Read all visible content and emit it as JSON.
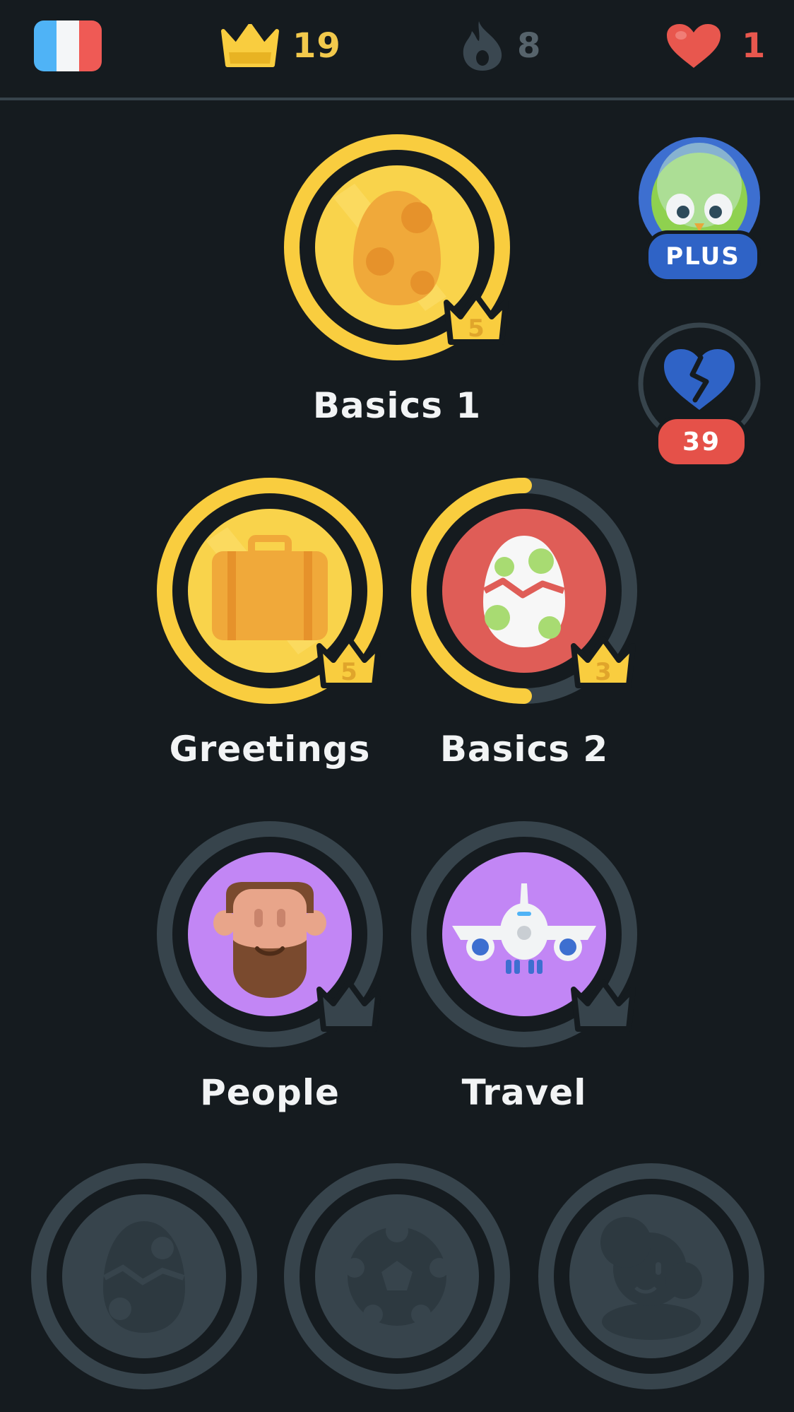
{
  "topbar": {
    "flag": {
      "name": "french-flag",
      "colors": [
        "#4fb3f6",
        "#f4f6f8",
        "#ef5a55"
      ]
    },
    "crowns": {
      "icon": "crown-icon",
      "count": "19"
    },
    "streak": {
      "icon": "flame-icon",
      "count": "8"
    },
    "hearts": {
      "icon": "heart-icon",
      "count": "1"
    }
  },
  "side": {
    "plus": {
      "label": "PLUS"
    },
    "heart_refill": {
      "icon": "broken-heart-icon",
      "count": "39"
    }
  },
  "skills": [
    {
      "label": "Basics 1",
      "icon": "egg-icon",
      "crown_level": "5",
      "progress": 1.0,
      "state": "gold"
    },
    {
      "label": "Greetings",
      "icon": "suitcase-icon",
      "crown_level": "5",
      "progress": 1.0,
      "state": "gold"
    },
    {
      "label": "Basics 2",
      "icon": "cracked-egg-icon",
      "crown_level": "3",
      "progress": 0.5,
      "state": "active"
    },
    {
      "label": "People",
      "icon": "bearded-man-icon",
      "crown_level": "",
      "progress": 0,
      "state": "unlocked"
    },
    {
      "label": "Travel",
      "icon": "airplane-icon",
      "crown_level": "",
      "progress": 0,
      "state": "unlocked"
    }
  ],
  "locked_skills": [
    {
      "icon": "locked-egg-icon"
    },
    {
      "icon": "locked-ball-icon"
    },
    {
      "icon": "locked-person-icon"
    }
  ],
  "colors": {
    "background": "#151b1f",
    "ring_gold": "#f9cd3f",
    "ring_gray": "#37444c",
    "gold": "#f9d34b",
    "red": "#df5d57",
    "purple": "#c286f5",
    "locked": "#3a4750"
  }
}
